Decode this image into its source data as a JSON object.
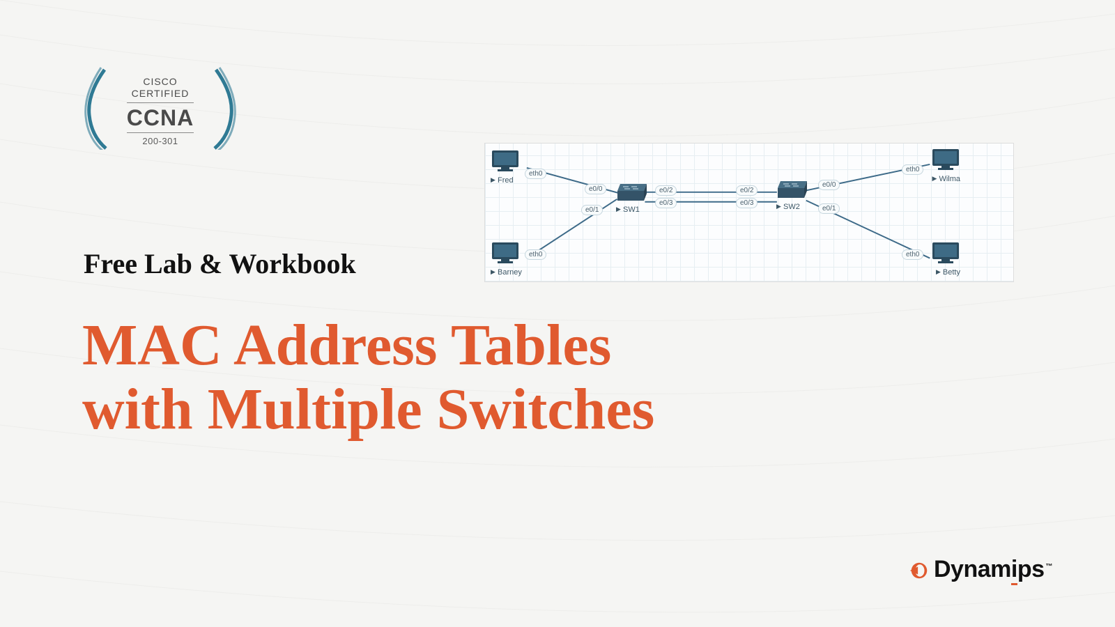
{
  "badge": {
    "line1": "CISCO",
    "line2": "CERTIFIED",
    "main": "CCNA",
    "code": "200-301"
  },
  "subtitle": "Free Lab & Workbook",
  "title_line1": "MAC Address Tables",
  "title_line2": "with Multiple Switches",
  "brand": {
    "name": "Dynamips",
    "tm": "™"
  },
  "diagram": {
    "hosts": {
      "fred": {
        "label": "Fred",
        "port": "eth0"
      },
      "barney": {
        "label": "Barney",
        "port": "eth0"
      },
      "wilma": {
        "label": "Wilma",
        "port": "eth0"
      },
      "betty": {
        "label": "Betty",
        "port": "eth0"
      }
    },
    "switches": {
      "sw1": {
        "label": "SW1"
      },
      "sw2": {
        "label": "SW2"
      }
    },
    "ports": {
      "sw1_e00": "e0/0",
      "sw1_e01": "e0/1",
      "sw1_e02": "e0/2",
      "sw1_e03": "e0/3",
      "sw2_e00": "e0/0",
      "sw2_e01": "e0/1",
      "sw2_e02": "e0/2",
      "sw2_e03": "e0/3"
    }
  }
}
